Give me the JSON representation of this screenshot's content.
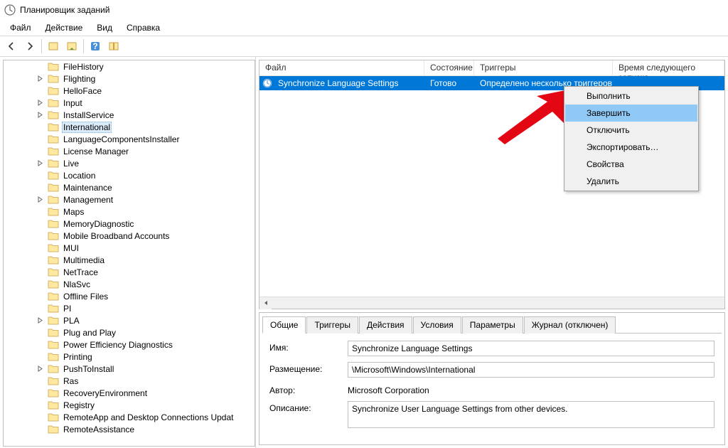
{
  "window": {
    "title": "Планировщик заданий"
  },
  "menu": {
    "file": "Файл",
    "action": "Действие",
    "view": "Вид",
    "help": "Справка"
  },
  "tree": {
    "items": [
      {
        "label": "FileHistory",
        "expandable": false
      },
      {
        "label": "Flighting",
        "expandable": true
      },
      {
        "label": "HelloFace",
        "expandable": false
      },
      {
        "label": "Input",
        "expandable": true
      },
      {
        "label": "InstallService",
        "expandable": true
      },
      {
        "label": "International",
        "expandable": false,
        "selected": true
      },
      {
        "label": "LanguageComponentsInstaller",
        "expandable": false
      },
      {
        "label": "License Manager",
        "expandable": false
      },
      {
        "label": "Live",
        "expandable": true
      },
      {
        "label": "Location",
        "expandable": false
      },
      {
        "label": "Maintenance",
        "expandable": false
      },
      {
        "label": "Management",
        "expandable": true
      },
      {
        "label": "Maps",
        "expandable": false
      },
      {
        "label": "MemoryDiagnostic",
        "expandable": false
      },
      {
        "label": "Mobile Broadband Accounts",
        "expandable": false
      },
      {
        "label": "MUI",
        "expandable": false
      },
      {
        "label": "Multimedia",
        "expandable": false
      },
      {
        "label": "NetTrace",
        "expandable": false
      },
      {
        "label": "NlaSvc",
        "expandable": false
      },
      {
        "label": "Offline Files",
        "expandable": false
      },
      {
        "label": "PI",
        "expandable": false
      },
      {
        "label": "PLA",
        "expandable": true
      },
      {
        "label": "Plug and Play",
        "expandable": false
      },
      {
        "label": "Power Efficiency Diagnostics",
        "expandable": false
      },
      {
        "label": "Printing",
        "expandable": false
      },
      {
        "label": "PushToInstall",
        "expandable": true
      },
      {
        "label": "Ras",
        "expandable": false
      },
      {
        "label": "RecoveryEnvironment",
        "expandable": false
      },
      {
        "label": "Registry",
        "expandable": false
      },
      {
        "label": "RemoteApp and Desktop Connections Updat",
        "expandable": false
      },
      {
        "label": "RemoteAssistance",
        "expandable": false
      }
    ]
  },
  "taskList": {
    "columns": {
      "file": "Файл",
      "state": "Состояние",
      "triggers": "Триггеры",
      "nextrun": "Время следующего запуска"
    },
    "row": {
      "name": "Synchronize Language Settings",
      "state": "Готово",
      "triggers": "Определено несколько триггеров"
    }
  },
  "contextMenu": {
    "run": "Выполнить",
    "end": "Завершить",
    "disable": "Отключить",
    "export": "Экспортировать…",
    "properties": "Свойства",
    "delete": "Удалить"
  },
  "details": {
    "tabs": {
      "general": "Общие",
      "triggers": "Триггеры",
      "actions": "Действия",
      "conditions": "Условия",
      "params": "Параметры",
      "history": "Журнал (отключен)"
    },
    "labels": {
      "name": "Имя:",
      "location": "Размещение:",
      "author": "Автор:",
      "description": "Описание:"
    },
    "values": {
      "name": "Synchronize Language Settings",
      "location": "\\Microsoft\\Windows\\International",
      "author": "Microsoft Corporation",
      "description": "Synchronize User Language Settings from other devices."
    }
  }
}
